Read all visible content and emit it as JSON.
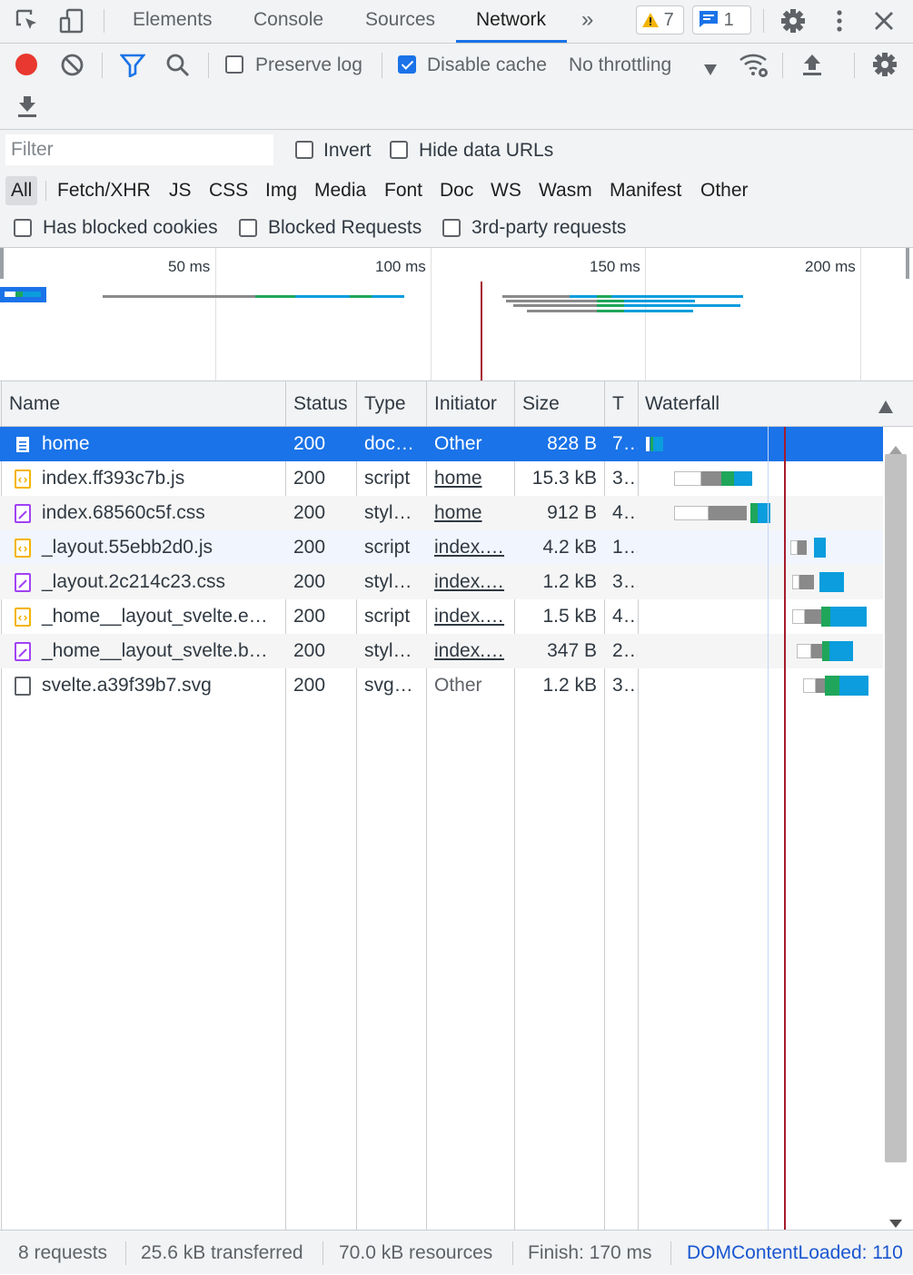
{
  "tabs": {
    "items": [
      "Elements",
      "Console",
      "Sources",
      "Network"
    ],
    "active": "Network",
    "more": "»",
    "warnings_count": "7",
    "messages_count": "1"
  },
  "toolbar": {
    "preserve_log_label": "Preserve log",
    "preserve_log_checked": false,
    "disable_cache_label": "Disable cache",
    "disable_cache_checked": true,
    "throttling_label": "No throttling"
  },
  "filter": {
    "placeholder": "Filter",
    "invert_label": "Invert",
    "hide_data_urls_label": "Hide data URLs",
    "types": [
      "All",
      "Fetch/XHR",
      "JS",
      "CSS",
      "Img",
      "Media",
      "Font",
      "Doc",
      "WS",
      "Wasm",
      "Manifest",
      "Other"
    ],
    "selected_type": "All",
    "has_blocked_cookies_label": "Has blocked cookies",
    "blocked_requests_label": "Blocked Requests",
    "third_party_label": "3rd-party requests"
  },
  "overview": {
    "ticks": [
      "50 ms",
      "100 ms",
      "150 ms",
      "200 ms"
    ]
  },
  "table": {
    "headers": {
      "name": "Name",
      "status": "Status",
      "type": "Type",
      "initiator": "Initiator",
      "size": "Size",
      "time": "T",
      "waterfall": "Waterfall"
    },
    "rows": [
      {
        "name": "home",
        "icon": "document-icon",
        "status": "200",
        "type": "doc…",
        "initiator": "Other",
        "initiator_link": false,
        "size": "828 B",
        "time": "7…"
      },
      {
        "name": "index.ff393c7b.js",
        "icon": "script-icon",
        "status": "200",
        "type": "script",
        "initiator": "home",
        "initiator_link": true,
        "size": "15.3 kB",
        "time": "3…"
      },
      {
        "name": "index.68560c5f.css",
        "icon": "stylesheet-icon",
        "status": "200",
        "type": "styl…",
        "initiator": "home",
        "initiator_link": true,
        "size": "912 B",
        "time": "4…"
      },
      {
        "name": "_layout.55ebb2d0.js",
        "icon": "script-icon",
        "status": "200",
        "type": "script",
        "initiator": "index.…",
        "initiator_link": true,
        "size": "4.2 kB",
        "time": "1…"
      },
      {
        "name": "_layout.2c214c23.css",
        "icon": "stylesheet-icon",
        "status": "200",
        "type": "styl…",
        "initiator": "index.…",
        "initiator_link": true,
        "size": "1.2 kB",
        "time": "3…"
      },
      {
        "name": "_home__layout_svelte.e…",
        "icon": "script-icon",
        "status": "200",
        "type": "script",
        "initiator": "index.…",
        "initiator_link": true,
        "size": "1.5 kB",
        "time": "4…"
      },
      {
        "name": "_home__layout_svelte.b…",
        "icon": "stylesheet-icon",
        "status": "200",
        "type": "styl…",
        "initiator": "index.…",
        "initiator_link": true,
        "size": "347 B",
        "time": "2…"
      },
      {
        "name": "svelte.a39f39b7.svg",
        "icon": "file-icon",
        "status": "200",
        "type": "svg…",
        "initiator": "Other",
        "initiator_link": false,
        "size": "1.2 kB",
        "time": "3…"
      }
    ]
  },
  "status": {
    "requests": "8 requests",
    "transferred": "25.6 kB transferred",
    "resources": "70.0 kB resources",
    "finish": "Finish: 170 ms",
    "dom_content_loaded": "DOMContentLoaded: 110"
  },
  "colors": {
    "accent": "#1a73e8",
    "record": "#e8382f",
    "queue": "#8a8a8a",
    "connect": "#1fa65a",
    "receive": "#0b9ddd",
    "load_line": "#a51c2c",
    "dcl_line": "#1a73e8"
  }
}
